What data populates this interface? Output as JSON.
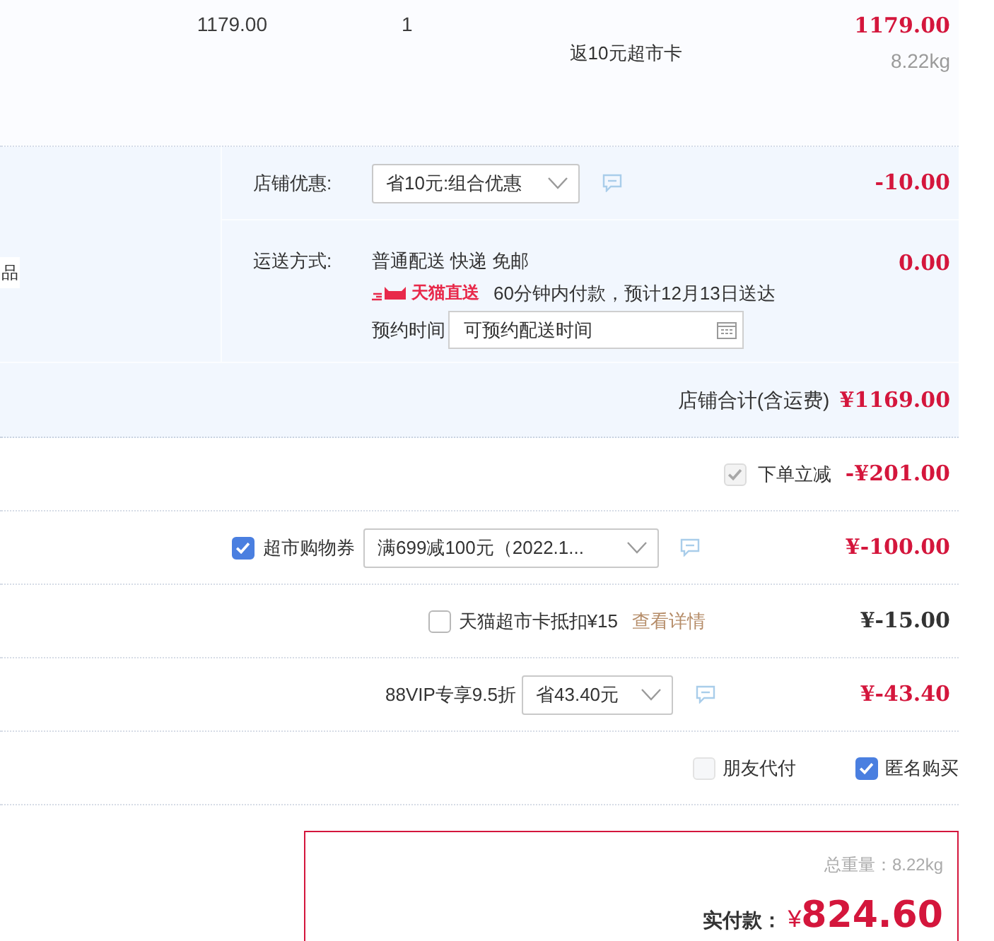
{
  "product": {
    "price": "1179.00",
    "quantity": "1",
    "promo": "返10元超市卡",
    "subtotal": "1179.00",
    "weight": "8.22kg"
  },
  "shop": {
    "left_fragment": "品",
    "discount": {
      "label": "店铺优惠:",
      "select": "省10元:组合优惠",
      "amount": "-10.00"
    },
    "shipping": {
      "label": "运送方式:",
      "method": "普通配送 快递 免邮",
      "badge": "天猫直送",
      "eta": "60分钟内付款，预计12月13日送达",
      "schedule_label": "预约时间",
      "schedule_placeholder": "可预约配送时间",
      "amount": "0.00"
    },
    "total_label": "店铺合计(含运费)",
    "total": "¥1169.00"
  },
  "adjustments": [
    {
      "kind": "instant",
      "label": "下单立减",
      "checked": true,
      "disabled": true,
      "amount": "-¥201.00"
    },
    {
      "kind": "coupon",
      "label": "超市购物券",
      "checked": true,
      "disabled": false,
      "select": "满699减100元（2022.1...",
      "amount": "¥-100.00"
    },
    {
      "kind": "card",
      "label": "天猫超市卡抵扣¥15",
      "checked": false,
      "disabled": false,
      "link": "查看详情",
      "amount": "¥-15.00"
    },
    {
      "kind": "vip",
      "label": "88VIP专享9.5折",
      "select": "省43.40元",
      "amount": "¥-43.40"
    }
  ],
  "options": [
    {
      "label": "朋友代付",
      "checked": false,
      "disabled": true
    },
    {
      "label": "匿名购买",
      "checked": true,
      "disabled": false
    }
  ],
  "summary": {
    "weight": "总重量：8.22kg",
    "pay_label": "实付款：",
    "currency": "¥",
    "pay_amount": "824.60"
  }
}
